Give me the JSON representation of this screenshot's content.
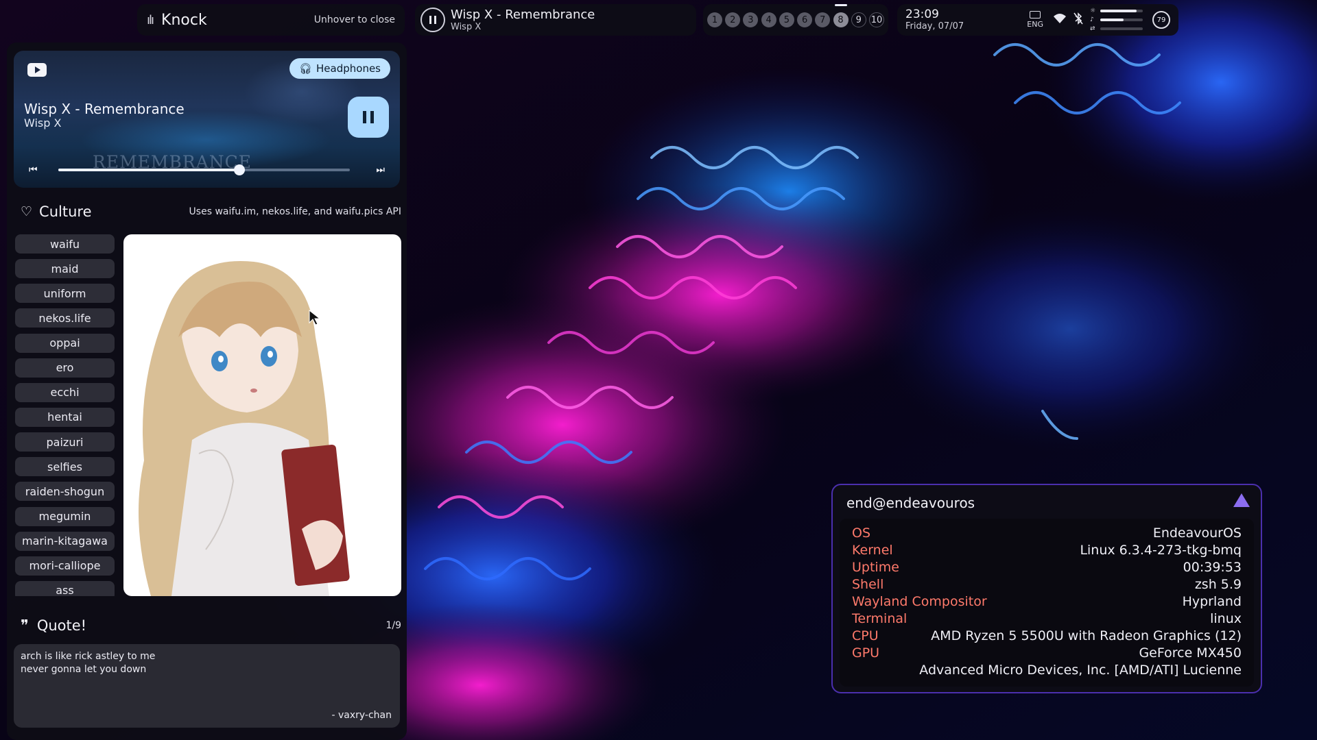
{
  "topbar": {
    "knock": {
      "title": "Knock",
      "hint": "Unhover to close",
      "icon": "audio-wave-icon"
    },
    "media": {
      "title": "Wisp X - Remembrance",
      "artist": "Wisp X",
      "icon": "pause-circle-icon"
    },
    "workspaces": [
      {
        "label": "1",
        "state": "occupied"
      },
      {
        "label": "2",
        "state": "occupied"
      },
      {
        "label": "3",
        "state": "occupied"
      },
      {
        "label": "4",
        "state": "occupied"
      },
      {
        "label": "5",
        "state": "occupied"
      },
      {
        "label": "6",
        "state": "occupied"
      },
      {
        "label": "7",
        "state": "occupied"
      },
      {
        "label": "8",
        "state": "active"
      },
      {
        "label": "9",
        "state": "empty"
      },
      {
        "label": "10",
        "state": "empty"
      }
    ],
    "clock": {
      "time": "23:09",
      "date": "Friday, 07/07"
    },
    "keyboard_layout": "ENG",
    "brightness_level": 0.85,
    "volume_level": 0.55,
    "battery": "79",
    "battery_level": 0.79
  },
  "player": {
    "title": "Wisp X - Remembrance",
    "artist": "Wisp X",
    "output_device": "Headphones",
    "progress": 0.62,
    "art_watermark": "REMEMBRANCE"
  },
  "culture": {
    "title": "Culture",
    "api_note": "Uses waifu.im, nekos.life, and waifu.pics API",
    "tags": [
      "waifu",
      "maid",
      "uniform",
      "nekos.life",
      "oppai",
      "ero",
      "ecchi",
      "hentai",
      "paizuri",
      "selfies",
      "raiden-shogun",
      "megumin",
      "marin-kitagawa",
      "mori-calliope",
      "ass"
    ]
  },
  "quote": {
    "title": "Quote!",
    "counter": "1/9",
    "line1": "arch is like rick astley to me",
    "line2": "never gonna let you down",
    "author": "- vaxry-chan"
  },
  "neofetch": {
    "header": "end@endeavouros",
    "rows": [
      {
        "key": "OS",
        "value": "EndeavourOS"
      },
      {
        "key": "Kernel",
        "value": "Linux 6.3.4-273-tkg-bmq"
      },
      {
        "key": "Uptime",
        "value": "00:39:53"
      },
      {
        "key": "Shell",
        "value": "zsh 5.9"
      },
      {
        "key": "Wayland Compositor",
        "value": "Hyprland"
      },
      {
        "key": "Terminal",
        "value": "linux"
      },
      {
        "key": "CPU",
        "value": "AMD Ryzen 5 5500U with Radeon Graphics (12)"
      },
      {
        "key": "GPU",
        "value": "GeForce MX450"
      },
      {
        "key": "",
        "value": "Advanced Micro Devices, Inc. [AMD/ATI] Lucienne"
      }
    ]
  },
  "colors": {
    "accent_purple": "#4b2fae",
    "fetch_key": "#ff7a6b",
    "player_button": "#a9d8ff"
  }
}
